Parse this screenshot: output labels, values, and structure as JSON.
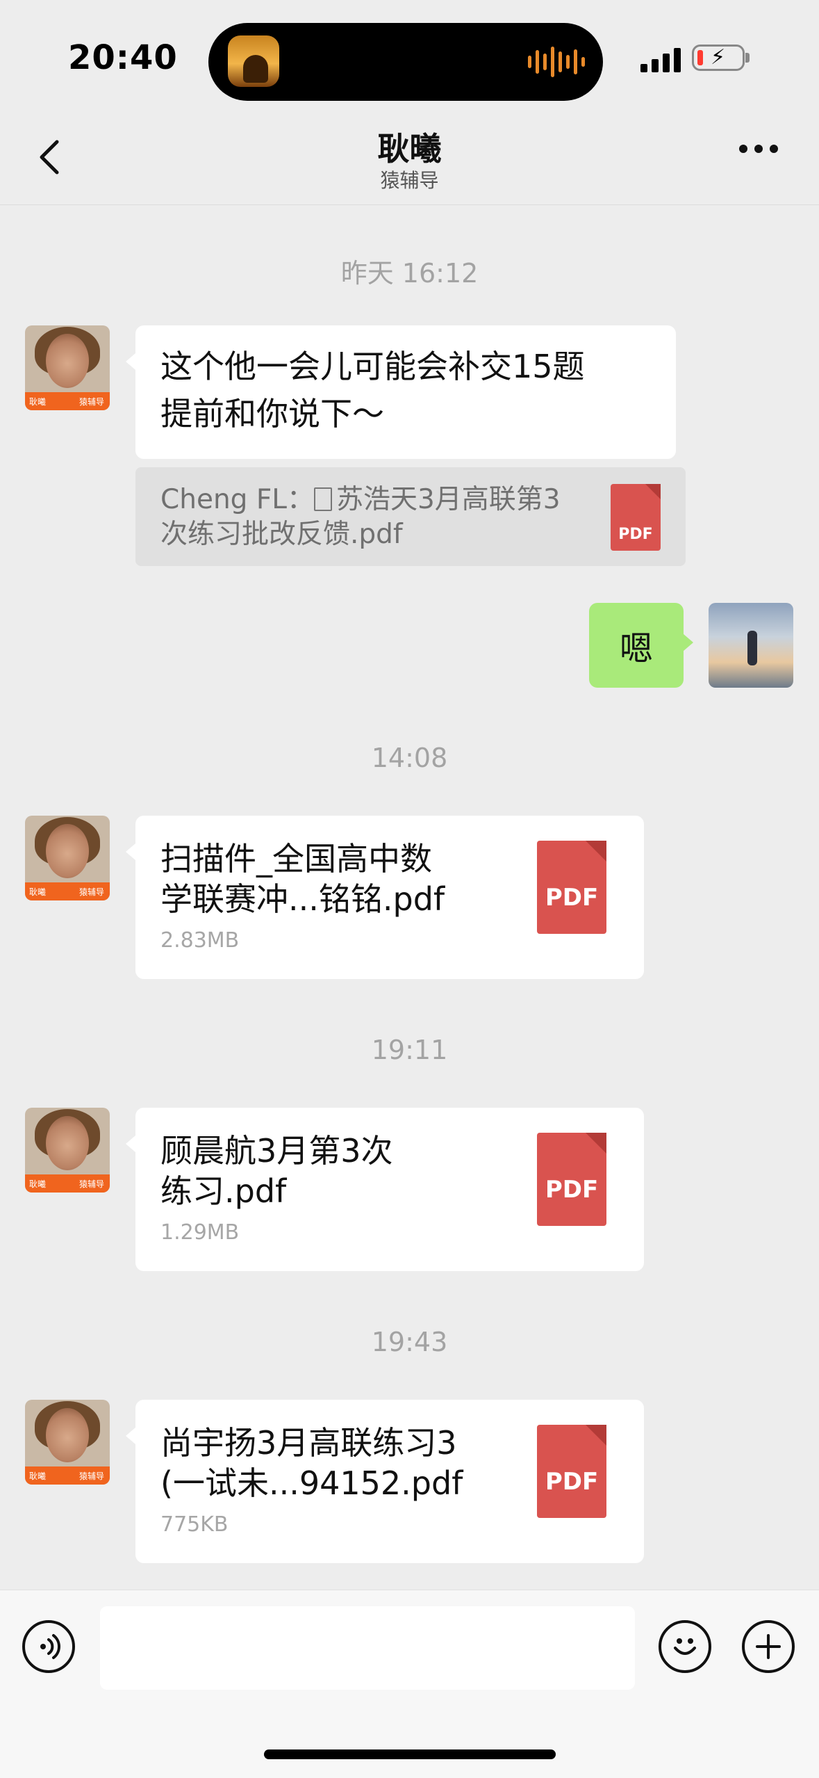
{
  "status_bar": {
    "time": "20:40"
  },
  "nav": {
    "title": "耿曦",
    "subtitle": "猿辅导"
  },
  "avatar_tag": {
    "name": "耿曦",
    "brand": "猿辅导"
  },
  "messages": {
    "ts1": "昨天 16:12",
    "m1_line1": "这个他一会儿可能会补交15题",
    "m1_line2": "提前和你说下～",
    "quote_line1": "Cheng FL：",
    "quote_file1": "苏浩天3月高联第3",
    "quote_line2": "次练习批改反馈.pdf",
    "reply": "嗯",
    "ts2": "14:08",
    "f1_line1": "扫描件_全国高中数",
    "f1_line2": "学联赛冲...铭铭.pdf",
    "f1_size": "2.83MB",
    "ts3": "19:11",
    "f2_line1": "顾晨航3月第3次",
    "f2_line2": "练习.pdf",
    "f2_size": "1.29MB",
    "ts4": "19:43",
    "f3_line1": "尚宇扬3月高联练习3",
    "f3_line2": "(一试未...94152.pdf",
    "f3_size": "775KB",
    "pdf_label": "PDF"
  },
  "input": {
    "placeholder": ""
  }
}
